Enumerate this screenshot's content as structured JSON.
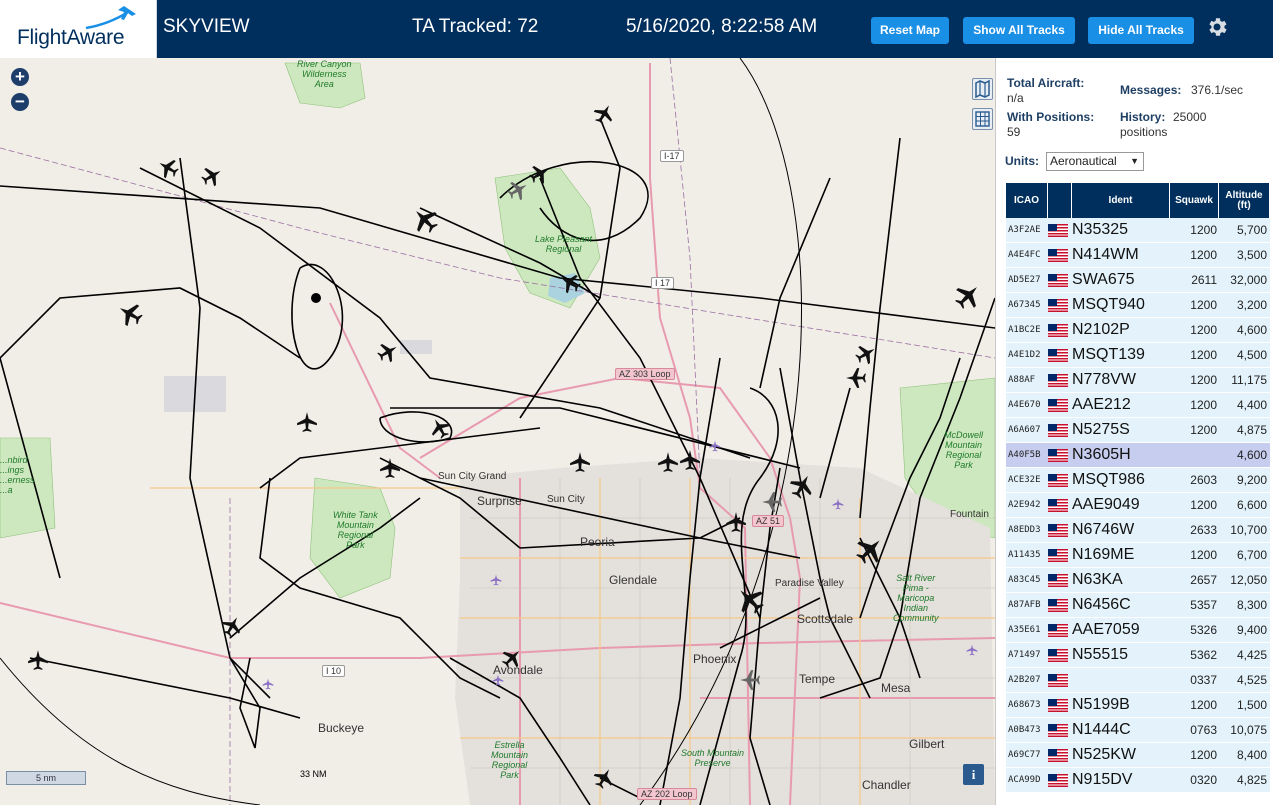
{
  "header": {
    "logo_text": "FlightAware",
    "title": "SKYVIEW",
    "ta_tracked": "TA Tracked: 72",
    "timestamp": "5/16/2020, 8:22:58 AM",
    "buttons": {
      "reset": "Reset Map",
      "show_all": "Show All Tracks",
      "hide_all": "Hide All Tracks"
    },
    "settings_icon": "gear-icon"
  },
  "map": {
    "zoom_in": "+",
    "zoom_out": "−",
    "scale_label": "5 nm",
    "range_label": "33 NM",
    "info_label": "i",
    "cities": [
      "Surprise",
      "Sun City",
      "Sun City Grand",
      "Peoria",
      "Glendale",
      "Avondale",
      "Phoenix",
      "Tempe",
      "Mesa",
      "Gilbert",
      "Chandler",
      "Buckeye",
      "Scottsdale",
      "Paradise Valley",
      "Fountain"
    ],
    "parks": [
      "River Canyon\nWilderness\nArea",
      "Lake Pleasant\nRegional",
      "White Tank\nMountain\nRegional\nPark",
      "McDowell\nMountain\nRegional\nPark",
      "Estrella\nMountain\nRegional\nPark",
      "South Mountain\nPreserve",
      "Salt River\nPima -\nMaricopa\nIndian\nCommunity",
      "...nbird\n...ings\n...erness\n...a"
    ],
    "roads": [
      "I-17",
      "I 17",
      "AZ 303 Loop",
      "AZ 51",
      "I 10",
      "AZ 202 Loop"
    ]
  },
  "stats": {
    "total_aircraft_label": "Total Aircraft:",
    "total_aircraft_value": "n/a",
    "with_positions_label": "With Positions:",
    "with_positions_value": "59",
    "messages_label": "Messages:",
    "messages_value": "376.1/sec",
    "history_label": "History:",
    "history_value": "25000",
    "history_unit": "positions",
    "units_label": "Units:",
    "units_value": "Aeronautical"
  },
  "table": {
    "columns": [
      "ICAO",
      "",
      "Ident",
      "Squawk",
      "Altitude (ft)"
    ],
    "selected_row": 9,
    "rows": [
      {
        "icao": "A3F2AE",
        "ident": "N35325",
        "squawk": "1200",
        "alt": "5,700"
      },
      {
        "icao": "A4E4FC",
        "ident": "N414WM",
        "squawk": "1200",
        "alt": "3,500"
      },
      {
        "icao": "AD5E27",
        "ident": "SWA675",
        "squawk": "2611",
        "alt": "32,000"
      },
      {
        "icao": "A67345",
        "ident": "MSQT940",
        "squawk": "1200",
        "alt": "3,200"
      },
      {
        "icao": "A1BC2E",
        "ident": "N2102P",
        "squawk": "1200",
        "alt": "4,600"
      },
      {
        "icao": "A4E1D2",
        "ident": "MSQT139",
        "squawk": "1200",
        "alt": "4,500"
      },
      {
        "icao": "A88AF",
        "ident": "N778VW",
        "squawk": "1200",
        "alt": "11,175"
      },
      {
        "icao": "A4E670",
        "ident": "AAE212",
        "squawk": "1200",
        "alt": "4,400"
      },
      {
        "icao": "A6A607",
        "ident": "N5275S",
        "squawk": "1200",
        "alt": "4,875"
      },
      {
        "icao": "A40F5B",
        "ident": "N3605H",
        "squawk": "",
        "alt": "4,600"
      },
      {
        "icao": "ACE32E",
        "ident": "MSQT986",
        "squawk": "2603",
        "alt": "9,200"
      },
      {
        "icao": "A2E942",
        "ident": "AAE9049",
        "squawk": "1200",
        "alt": "6,600"
      },
      {
        "icao": "A8EDD3",
        "ident": "N6746W",
        "squawk": "2633",
        "alt": "10,700"
      },
      {
        "icao": "A11435",
        "ident": "N169ME",
        "squawk": "1200",
        "alt": "6,700"
      },
      {
        "icao": "A83C45",
        "ident": "N63KA",
        "squawk": "2657",
        "alt": "12,050"
      },
      {
        "icao": "A87AFB",
        "ident": "N6456C",
        "squawk": "5357",
        "alt": "8,300"
      },
      {
        "icao": "A35E61",
        "ident": "AAE7059",
        "squawk": "5326",
        "alt": "9,400"
      },
      {
        "icao": "A71497",
        "ident": "N55515",
        "squawk": "5362",
        "alt": "4,425"
      },
      {
        "icao": "A2B207",
        "ident": "",
        "squawk": "0337",
        "alt": "4,525"
      },
      {
        "icao": "A68673",
        "ident": "N5199B",
        "squawk": "1200",
        "alt": "1,500"
      },
      {
        "icao": "A0B473",
        "ident": "N1444C",
        "squawk": "0763",
        "alt": "10,075"
      },
      {
        "icao": "A69C77",
        "ident": "N525KW",
        "squawk": "1200",
        "alt": "8,400"
      },
      {
        "icao": "ACA99D",
        "ident": "N915DV",
        "squawk": "0320",
        "alt": "4,825"
      }
    ]
  },
  "colors": {
    "header_bg": "#002f5d",
    "button_bg": "#1a8fe6",
    "row_bg": "#e4f3fb",
    "row_selected": "#c7cdee",
    "track": "#000000"
  }
}
